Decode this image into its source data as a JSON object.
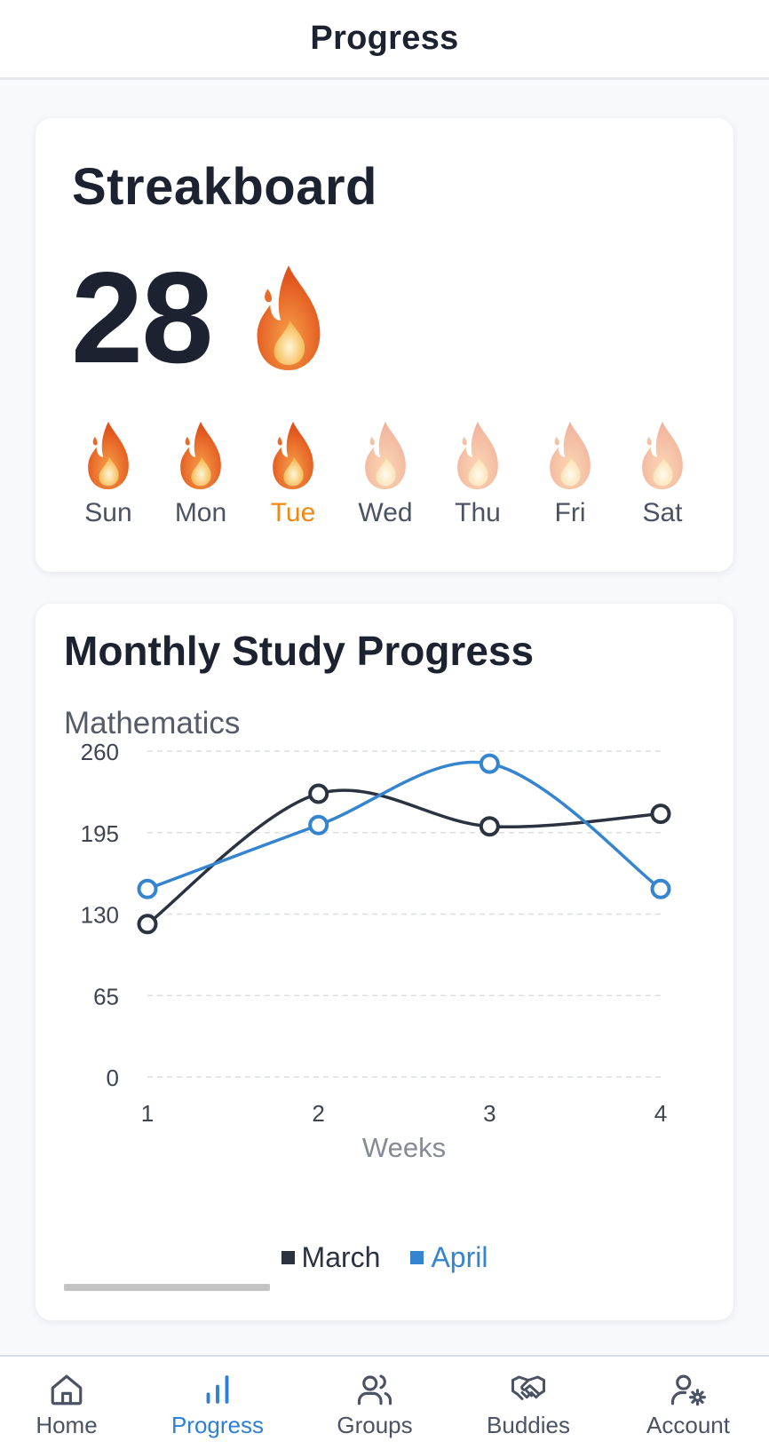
{
  "header": {
    "title": "Progress"
  },
  "streak": {
    "title": "Streakboard",
    "count": "28",
    "count_icon": "fire-icon",
    "days": [
      {
        "label": "Sun",
        "status": "done"
      },
      {
        "label": "Mon",
        "status": "done"
      },
      {
        "label": "Tue",
        "status": "today"
      },
      {
        "label": "Wed",
        "status": "pending"
      },
      {
        "label": "Thu",
        "status": "pending"
      },
      {
        "label": "Fri",
        "status": "pending"
      },
      {
        "label": "Sat",
        "status": "pending"
      }
    ],
    "colors": {
      "today_label": "#f08812",
      "flame": "#e8571c"
    }
  },
  "progress": {
    "title": "Monthly Study Progress",
    "subject": "Mathematics"
  },
  "chart_data": {
    "type": "line",
    "x": [
      1,
      2,
      3,
      4
    ],
    "xlabel": "Weeks",
    "ylabel": "",
    "ylim": [
      0,
      260
    ],
    "yticks": [
      0,
      65,
      130,
      195,
      260
    ],
    "grid": true,
    "legend": "bottom-center",
    "series": [
      {
        "name": "March",
        "values": [
          122,
          226,
          200,
          210
        ],
        "color": "#2b3240"
      },
      {
        "name": "April",
        "values": [
          150,
          201,
          250,
          150
        ],
        "color": "#3584cf"
      }
    ]
  },
  "bottom_nav": {
    "items": [
      {
        "label": "Home",
        "icon": "home-icon",
        "active": false
      },
      {
        "label": "Progress",
        "icon": "bar-chart-icon",
        "active": true
      },
      {
        "label": "Groups",
        "icon": "users-icon",
        "active": false
      },
      {
        "label": "Buddies",
        "icon": "handshake-icon",
        "active": false
      },
      {
        "label": "Account",
        "icon": "user-settings-icon",
        "active": false
      }
    ]
  }
}
